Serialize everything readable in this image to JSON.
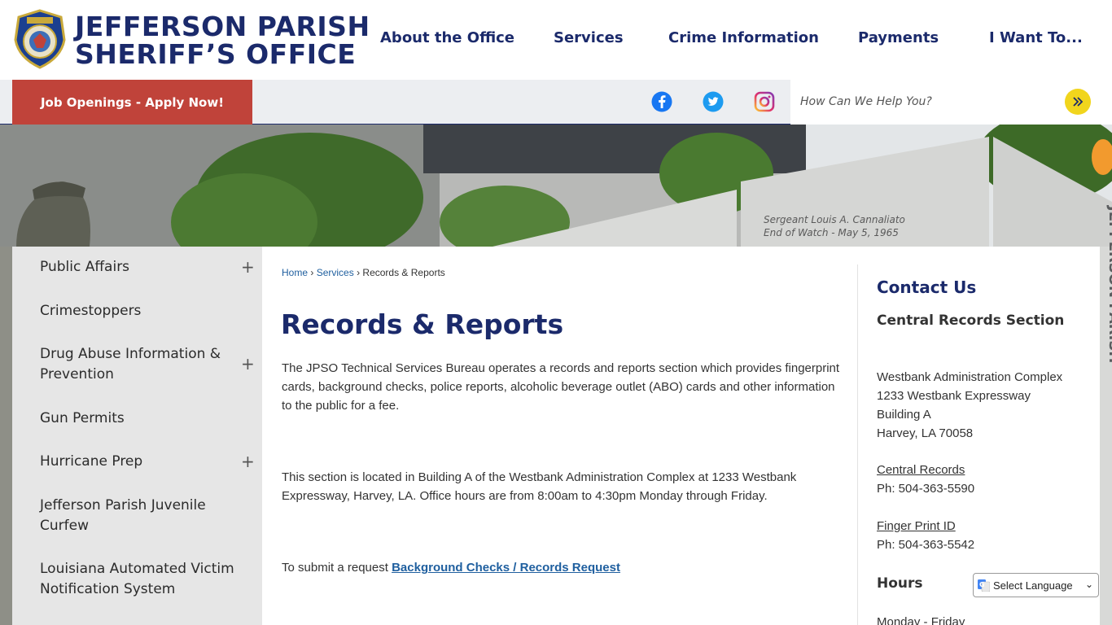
{
  "header": {
    "title_line1": "JEFFERSON PARISH",
    "title_line2": "SHERIFF’S OFFICE",
    "nav": [
      "About the Office",
      "Services",
      "Crime Information",
      "Payments",
      "I Want To..."
    ]
  },
  "bar": {
    "jobs_label": "Job Openings - Apply Now!",
    "social_icons": [
      "facebook-icon",
      "twitter-icon",
      "instagram-icon"
    ],
    "search_placeholder": "How Can We Help You?"
  },
  "hero": {
    "memorial_line1": "Sergeant Louis A. Cannaliato",
    "memorial_line2": "End of Watch - May 5, 1965",
    "vertical_text": "JEFFERSON PARISH"
  },
  "sidebar": {
    "items": [
      {
        "label": "Public Affairs",
        "expandable": true
      },
      {
        "label": "Crimestoppers",
        "expandable": false
      },
      {
        "label": "Drug Abuse Information & Prevention",
        "expandable": true
      },
      {
        "label": "Gun Permits",
        "expandable": false
      },
      {
        "label": "Hurricane Prep",
        "expandable": true
      },
      {
        "label": "Jefferson Parish Juvenile Curfew",
        "expandable": false
      },
      {
        "label": "Louisiana Automated Victim Notification System",
        "expandable": false
      }
    ],
    "plus": "+"
  },
  "breadcrumb": {
    "home": "Home",
    "services": "Services",
    "current": "Records & Reports",
    "sep": "›"
  },
  "main": {
    "title": "Records & Reports",
    "para1": "The JPSO Technical Services Bureau operates a records and reports section which provides fingerprint cards, background checks, police reports, alcoholic beverage outlet (ABO) cards and other information to the public for a fee.",
    "para2": "This section is located in Building A of the Westbank Administration Complex at 1233 Westbank Expressway, Harvey, LA.  Office hours are from 8:00am to 4:30pm Monday through Friday.",
    "para3_prefix": "To submit a request ",
    "para3_link": "Background Checks / Records Request"
  },
  "contact": {
    "title": "Contact Us",
    "subtitle": "Central Records Section",
    "address": [
      "Westbank Administration Complex",
      "1233 Westbank Expressway",
      "Building A",
      "Harvey, LA 70058"
    ],
    "central_records_label": "Central Records",
    "central_records_phone": "Ph: 504-363-5590",
    "fingerprint_label": "Finger Print ID",
    "fingerprint_phone": "Ph: 504-363-5542",
    "hours_title": "Hours",
    "hours_line": "Monday - Friday"
  },
  "translate": {
    "label": "Select Language"
  },
  "colors": {
    "navy": "#1b2a6b",
    "jobs_red": "#c0433a",
    "search_yellow": "#f1d51d",
    "link_blue": "#1f5f9f"
  }
}
